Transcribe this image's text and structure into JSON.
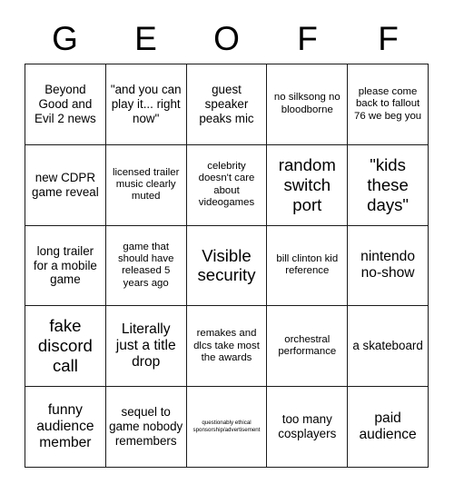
{
  "card": {
    "title_letters": [
      "G",
      "E",
      "O",
      "F",
      "F"
    ],
    "rows": [
      [
        {
          "text": "Beyond Good and Evil 2 news",
          "size": "md"
        },
        {
          "text": "\"and you can play it... right now\"",
          "size": "md"
        },
        {
          "text": "guest speaker peaks mic",
          "size": "md"
        },
        {
          "text": "no silksong no bloodborne",
          "size": "sm"
        },
        {
          "text": "please come back to fallout 76 we beg you",
          "size": "sm"
        }
      ],
      [
        {
          "text": "new CDPR game reveal",
          "size": "md"
        },
        {
          "text": "licensed trailer music clearly muted",
          "size": "sm"
        },
        {
          "text": "celebrity doesn't care about videogames",
          "size": "sm"
        },
        {
          "text": "random switch port",
          "size": "xl"
        },
        {
          "text": "\"kids these days\"",
          "size": "xl"
        }
      ],
      [
        {
          "text": "long trailer for a mobile game",
          "size": "md"
        },
        {
          "text": "game that should have released 5 years ago",
          "size": "sm"
        },
        {
          "text": "Visible security",
          "size": "xl"
        },
        {
          "text": "bill clinton kid reference",
          "size": "sm"
        },
        {
          "text": "nintendo no-show",
          "size": "lg"
        }
      ],
      [
        {
          "text": "fake discord call",
          "size": "xl"
        },
        {
          "text": "Literally just a title drop",
          "size": "lg"
        },
        {
          "text": "remakes and dlcs take most the awards",
          "size": "sm"
        },
        {
          "text": "orchestral performance",
          "size": "sm"
        },
        {
          "text": "a skateboard",
          "size": "md"
        }
      ],
      [
        {
          "text": "funny audience member",
          "size": "lg"
        },
        {
          "text": "sequel to game nobody remembers",
          "size": "md"
        },
        {
          "text": "questionably ethical sponsorship/advertisement",
          "size": "xs"
        },
        {
          "text": "too many cosplayers",
          "size": "md"
        },
        {
          "text": "paid audience",
          "size": "lg"
        }
      ]
    ]
  },
  "colors": {
    "background": "#ffffff",
    "border": "#1a1a1a",
    "text": "#000000"
  }
}
